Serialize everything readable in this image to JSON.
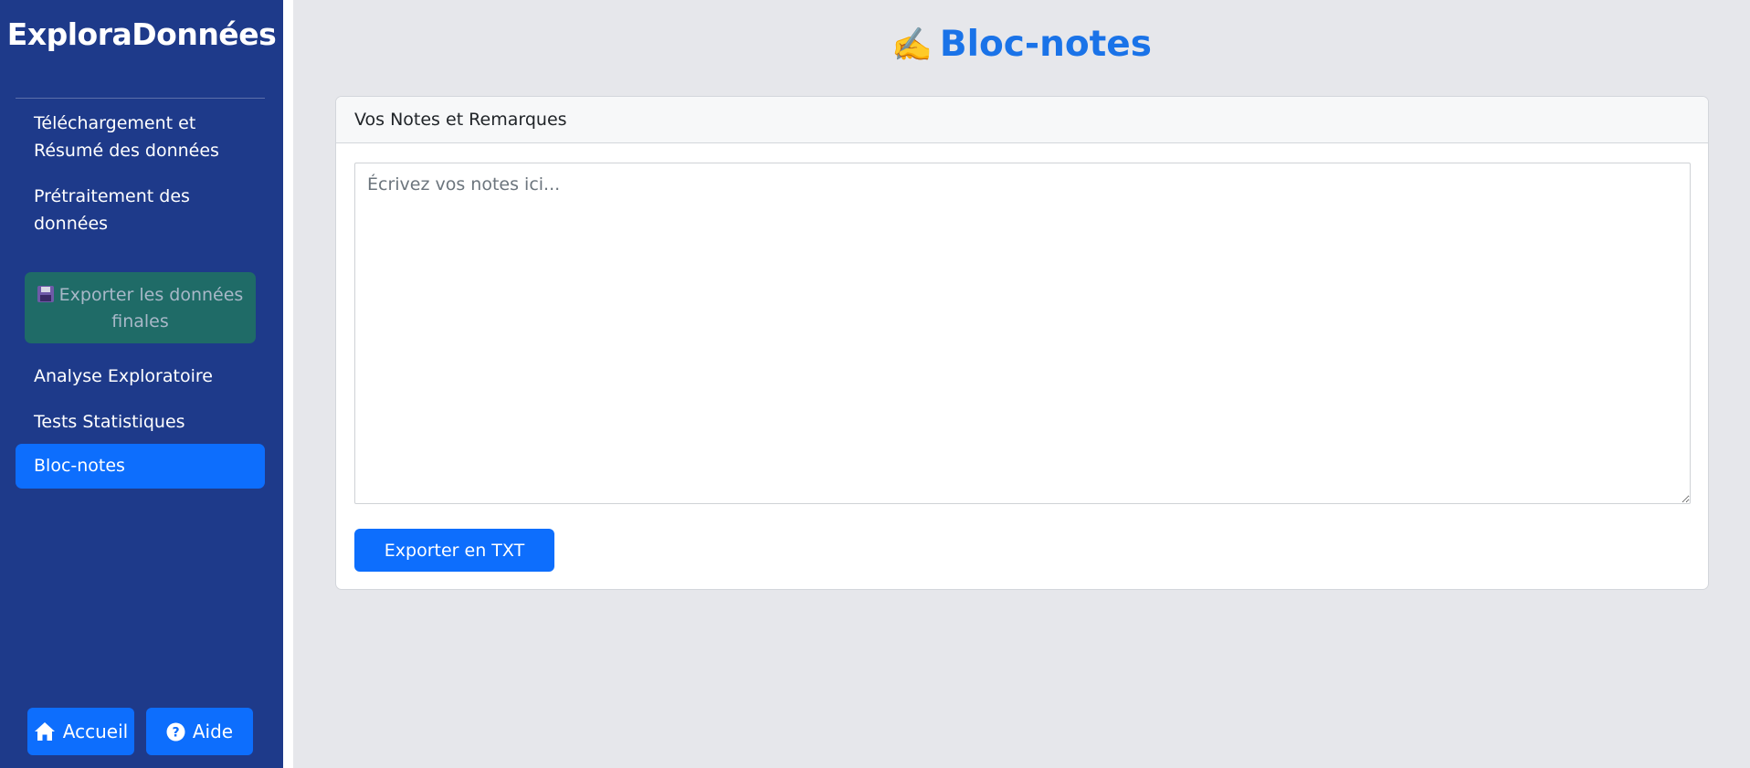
{
  "app": {
    "brand": "ExploraDonnées"
  },
  "sidebar": {
    "items": [
      {
        "label": "Téléchargement et Résumé des données"
      },
      {
        "label": "Prétraitement des données"
      },
      {
        "label": "Exporter les données finales",
        "icon": "floppy-disk-icon"
      },
      {
        "label": "Analyse Exploratoire"
      },
      {
        "label": "Tests Statistiques"
      },
      {
        "label": "Bloc-notes",
        "active": true
      }
    ],
    "footer": {
      "home_label": "Accueil",
      "home_icon": "home-icon",
      "help_label": "Aide",
      "help_icon": "question-circle-icon"
    }
  },
  "main": {
    "title_icon": "✍️",
    "title": "Bloc-notes",
    "card": {
      "header": "Vos Notes et Remarques",
      "notes_placeholder": "Écrivez vos notes ici...",
      "notes_value": "",
      "export_label": "Exporter en TXT"
    }
  },
  "colors": {
    "sidebar_bg": "#1e3a8a",
    "primary": "#0d6efd",
    "export_bg": "#1f6b67",
    "title_color": "#1a73e8",
    "page_bg": "#e6e7eb"
  }
}
